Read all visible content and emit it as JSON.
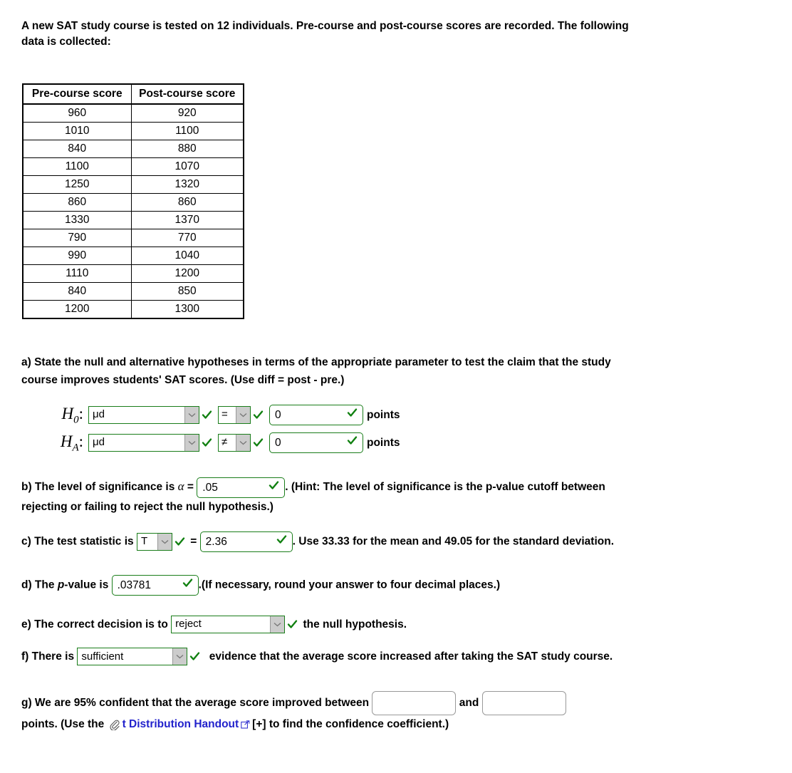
{
  "intro": {
    "text": "A new SAT study course is tested on 12 individuals. Pre-course and post-course scores are recorded. The following data is collected:"
  },
  "table": {
    "headers": [
      "Pre-course score",
      "Post-course score"
    ],
    "rows": [
      [
        "960",
        "920"
      ],
      [
        "1010",
        "1100"
      ],
      [
        "840",
        "880"
      ],
      [
        "1100",
        "1070"
      ],
      [
        "1250",
        "1320"
      ],
      [
        "860",
        "860"
      ],
      [
        "1330",
        "1370"
      ],
      [
        "790",
        "770"
      ],
      [
        "990",
        "1040"
      ],
      [
        "1110",
        "1200"
      ],
      [
        "840",
        "850"
      ],
      [
        "1200",
        "1300"
      ]
    ]
  },
  "parts": {
    "a": {
      "prompt": "a) State the null and alternative hypotheses in terms of the appropriate parameter to test the claim that the study course improves students' SAT scores. (Use diff = post - pre.)",
      "null": {
        "label": "H",
        "subscript": "0",
        "parameter": "μd",
        "operator": "=",
        "value": "0",
        "units": "points"
      },
      "alt": {
        "label": "H",
        "subscript": "A",
        "parameter": "μd",
        "operator": "≠",
        "value": "0",
        "units": "points"
      }
    },
    "b": {
      "prefix": "b) The level of significance is",
      "symbol": "α",
      "equals": "=",
      "value": ".05",
      "suffix": ". (Hint: The level of significance is the p-value cutoff between rejecting or failing to reject the null hypothesis.)"
    },
    "c": {
      "prefix": "c) The test statistic is",
      "statistic": "T",
      "equals": "=",
      "value": "2.36",
      "suffix": ". Use 33.33 for the mean and 49.05 for the standard deviation."
    },
    "d": {
      "prefix_1": "d) The ",
      "prefix_italic": "p",
      "prefix_2": "-value is",
      "value": ".03781",
      "suffix": ".(If necessary, round your answer to four decimal places.)"
    },
    "e": {
      "prefix": "e) The correct decision is to",
      "decision": "reject",
      "suffix": "the null hypothesis."
    },
    "f": {
      "prefix": "f) There is",
      "evidence": "sufficient",
      "suffix": "evidence that the average score increased after taking the SAT study course."
    },
    "g": {
      "prefix": "g) We are 95% confident that the average score improved between",
      "lower_value": "",
      "conjunction": "and",
      "upper_value": "",
      "suffix_1": "points. (Use the",
      "link_text": "t Distribution Handout",
      "plus_tag": "[+]",
      "suffix_2": "to find the confidence coefficient.)"
    }
  },
  "icons": {
    "checkmark": "check-icon",
    "chevron": "chevron-down-icon",
    "paperclip": "paperclip-icon",
    "external": "external-link-icon"
  },
  "colors": {
    "correct_green": "#1a7d1a",
    "link_blue": "#2222cc",
    "arrow_gray": "#cccccc",
    "blank_border": "#999999"
  }
}
